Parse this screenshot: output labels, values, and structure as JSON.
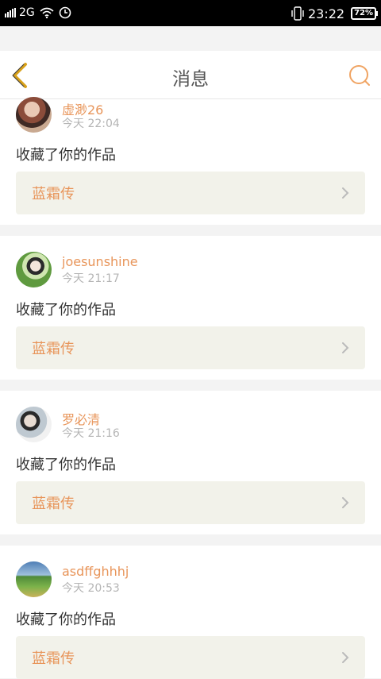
{
  "status_bar": {
    "network": "2G",
    "time": "23:22",
    "battery": "72%"
  },
  "header": {
    "title": "消息"
  },
  "notifications": [
    {
      "user": "虚渺26",
      "time": "今天 22:04",
      "action": "收藏了你的作品",
      "work": "蓝霜传"
    },
    {
      "user": "joesunshine",
      "time": "今天 21:17",
      "action": "收藏了你的作品",
      "work": "蓝霜传"
    },
    {
      "user": "罗必清",
      "time": "今天 21:16",
      "action": "收藏了你的作品",
      "work": "蓝霜传"
    },
    {
      "user": "asdffghhhj",
      "time": "今天 20:53",
      "action": "收藏了你的作品",
      "work": "蓝霜传"
    }
  ],
  "colors": {
    "accent": "#e8955a",
    "work_bg": "#f2f2ea",
    "page_bg": "#f3f3f3"
  }
}
